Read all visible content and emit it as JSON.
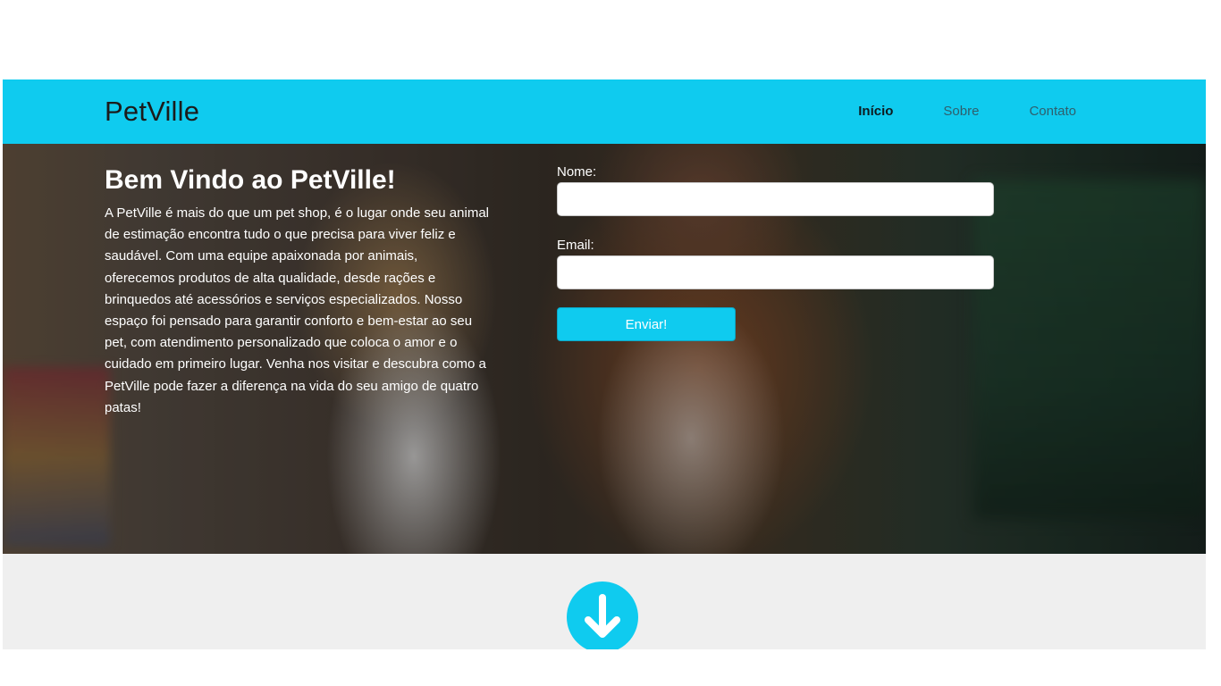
{
  "navbar": {
    "brand": "PetVille",
    "links": [
      {
        "label": "Início",
        "active": true
      },
      {
        "label": "Sobre",
        "active": false
      },
      {
        "label": "Contato",
        "active": false
      }
    ]
  },
  "hero": {
    "title": "Bem Vindo ao PetVille!",
    "description": "A PetVille é mais do que um pet shop, é o lugar onde seu animal de estimação encontra tudo o que precisa para viver feliz e saudável. Com uma equipe apaixonada por animais, oferecemos produtos de alta qualidade, desde rações e brinquedos até acessórios e serviços especializados. Nosso espaço foi pensado para garantir conforto e bem-estar ao seu pet, com atendimento personalizado que coloca o amor e o cuidado em primeiro lugar. Venha nos visitar e descubra como a PetVille pode fazer a diferença na vida do seu amigo de quatro patas!"
  },
  "form": {
    "name_label": "Nome:",
    "name_value": "",
    "email_label": "Email:",
    "email_value": "",
    "submit_label": "Enviar!"
  },
  "scroll_button": {
    "icon": "arrow-down-icon"
  },
  "colors": {
    "accent": "#0fcbef",
    "bottom_band": "#efefef"
  }
}
